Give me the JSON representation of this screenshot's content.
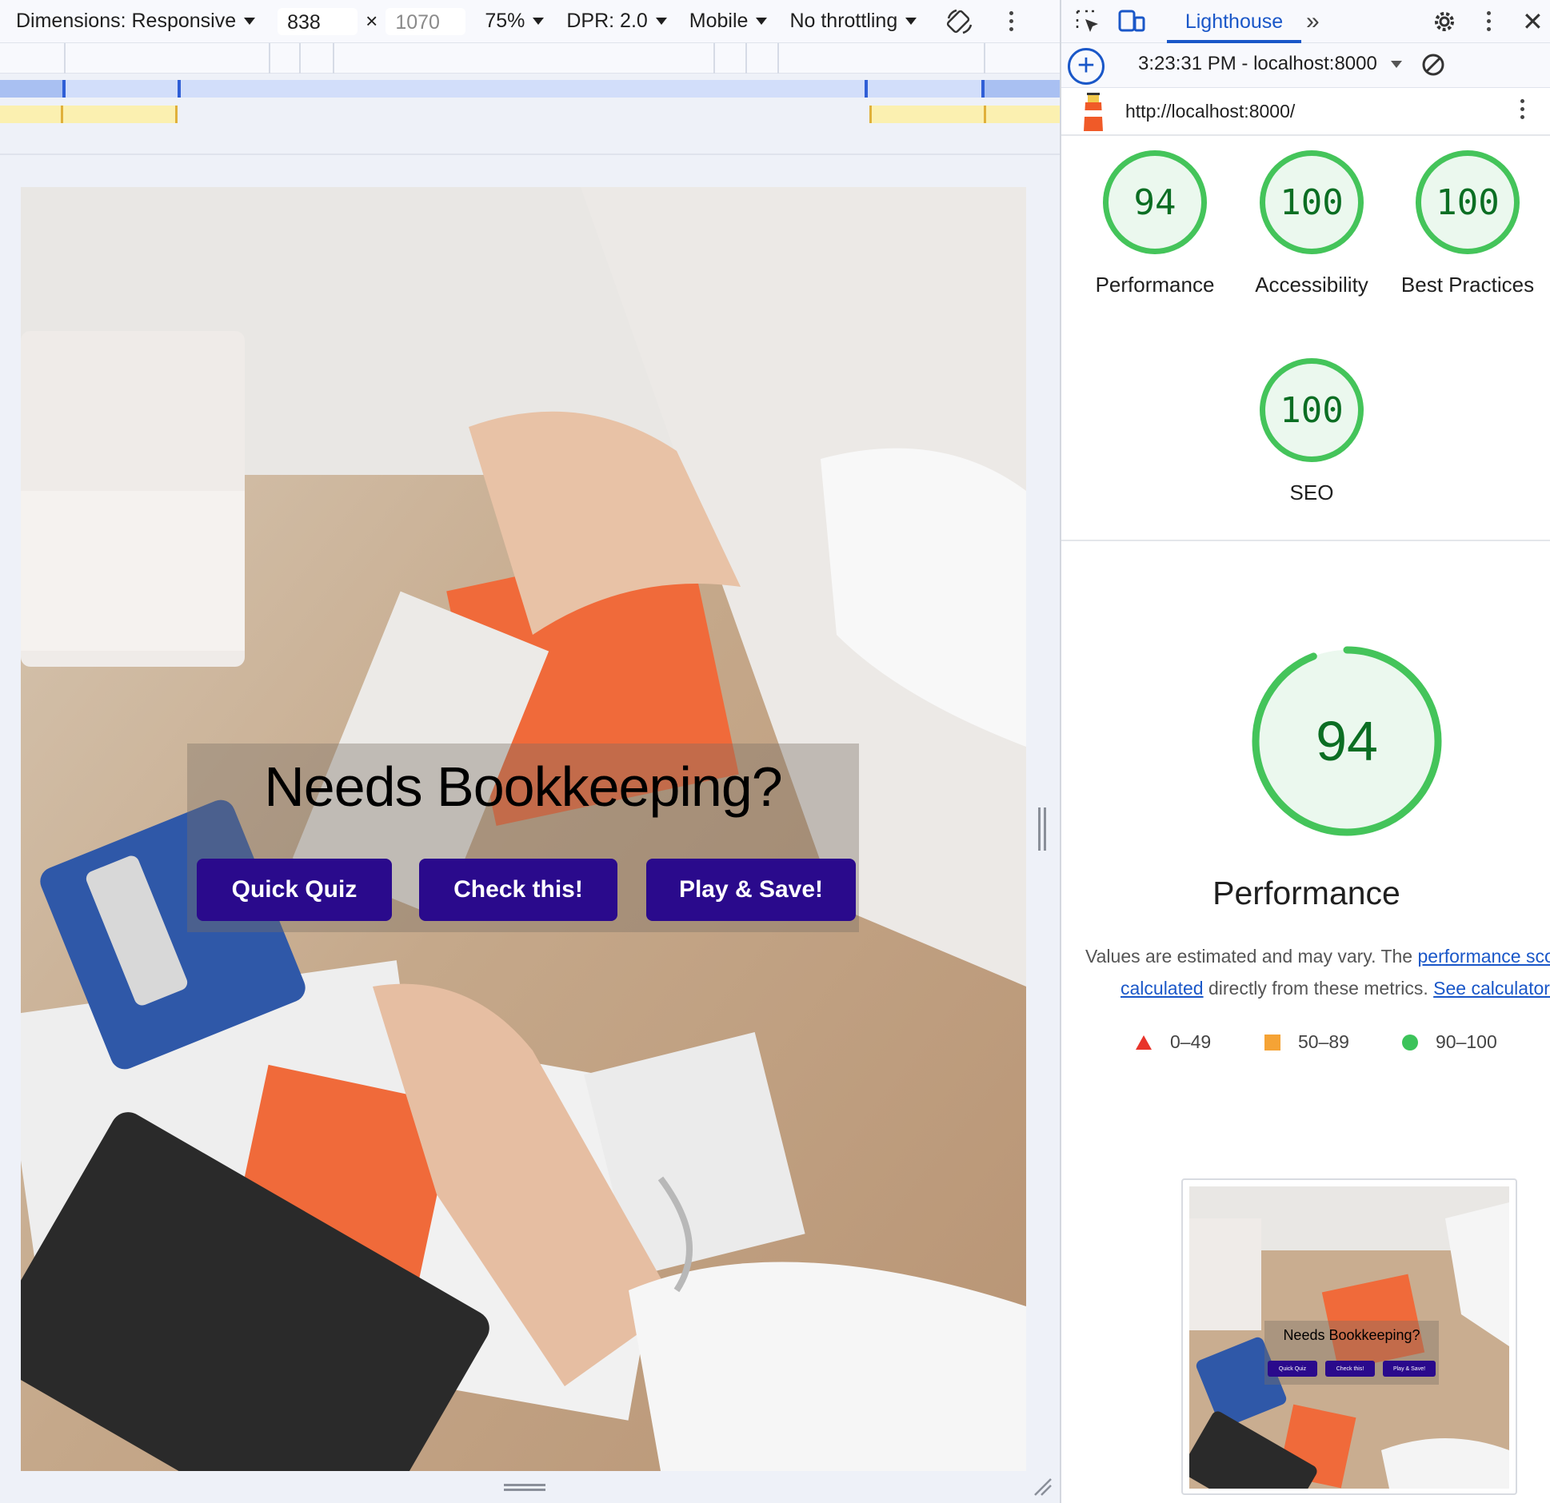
{
  "device_toolbar": {
    "dimensions_label": "Dimensions: Responsive",
    "width_value": "838",
    "height_placeholder": "1070",
    "times": "×",
    "zoom": "75%",
    "dpr": "DPR: 2.0",
    "device_mode": "Mobile",
    "throttling": "No throttling"
  },
  "page": {
    "hero_title": "Needs Bookkeeping?",
    "buttons": [
      "Quick Quiz",
      "Check this!",
      "Play & Save!"
    ],
    "button_color": "#2a0a8c"
  },
  "devtools": {
    "active_tab": "Lighthouse",
    "run_label": "3:23:31 PM - localhost:8000",
    "url": "http://localhost:8000/"
  },
  "lighthouse": {
    "scores": [
      {
        "value": "94",
        "label": "Performance"
      },
      {
        "value": "100",
        "label": "Accessibility"
      },
      {
        "value": "100",
        "label": "Best Practices"
      },
      {
        "value": "100",
        "label": "SEO"
      }
    ],
    "performance_score": 94,
    "performance_title": "Performance",
    "note_text_1": "Values are estimated and may vary. The ",
    "note_link_1": "performance score is",
    "note_link_1b": "calculated",
    "note_text_2": " directly from these metrics. ",
    "note_link_2": "See calculator.",
    "legend": [
      {
        "range": "0–49",
        "shape": "triangle",
        "color": "#e8342b"
      },
      {
        "range": "50–89",
        "shape": "square",
        "color": "#f5a335"
      },
      {
        "range": "90–100",
        "shape": "circle",
        "color": "#3cc35a"
      }
    ],
    "gauge_color": "#44c45a",
    "thumbnail": {
      "title": "Needs Bookkeeping?",
      "buttons": [
        "Quick Quiz",
        "Check this!",
        "Play & Save!"
      ]
    }
  }
}
